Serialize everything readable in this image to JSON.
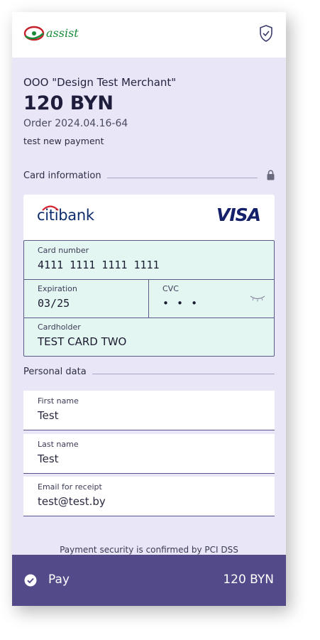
{
  "header": {
    "logo_text": "assist",
    "logo_icon": "assist-logo",
    "security_icon": "shield-check-icon"
  },
  "merchant": {
    "name": "OOO \"Design Test Merchant\"",
    "amount": "120 BYN",
    "order": "Order 2024.04.16-64",
    "description": "test new payment"
  },
  "card_section": {
    "title": "Card information",
    "lock_icon": "lock-icon",
    "bank_name": "citibank",
    "network": "VISA",
    "number_label": "Card number",
    "number_value": "4111 1111 1111 1111",
    "expiration_label": "Expiration",
    "expiration_value": "03/25",
    "cvc_label": "CVC",
    "cvc_value": "• • •",
    "cardholder_label": "Cardholder",
    "cardholder_value": "TEST CARD TWO"
  },
  "personal_section": {
    "title": "Personal data",
    "first_name_label": "First name",
    "first_name_value": "Test",
    "last_name_label": "Last name",
    "last_name_value": "Test",
    "email_label": "Email for receipt",
    "email_value": "test@test.by"
  },
  "footer": {
    "pci_text": "Payment security is confirmed by PCI DSS",
    "pay_label": "Pay",
    "pay_amount": "120 BYN"
  },
  "colors": {
    "background": "#e9e6f8",
    "pay_button": "#534a8a",
    "card_fields": "#e4f6f1",
    "brand_green": "#1b8a3a",
    "brand_red": "#c8202a"
  }
}
